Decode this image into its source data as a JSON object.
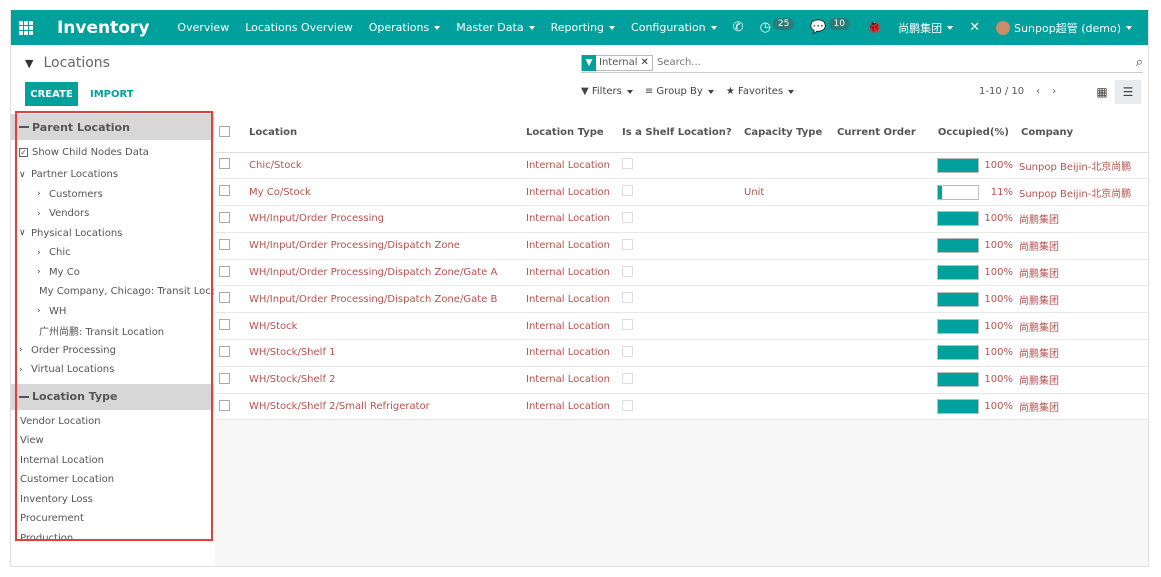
{
  "navbar": {
    "brand": "Inventory",
    "menu": [
      {
        "label": "Overview",
        "dropdown": false
      },
      {
        "label": "Locations Overview",
        "dropdown": false
      },
      {
        "label": "Operations",
        "dropdown": true
      },
      {
        "label": "Master Data",
        "dropdown": true
      },
      {
        "label": "Reporting",
        "dropdown": true
      },
      {
        "label": "Configuration",
        "dropdown": true
      }
    ],
    "activity_count": "25",
    "message_count": "10",
    "company_switcher": "尚鹏集团",
    "user": "Sunpop超管 (demo)"
  },
  "control_panel": {
    "breadcrumb": "Locations",
    "create_label": "CREATE",
    "import_label": "IMPORT",
    "search": {
      "facet_value": "Internal",
      "placeholder": "Search..."
    },
    "filters_label": "Filters",
    "group_by_label": "Group By",
    "favorites_label": "Favorites",
    "pager": "1-10 / 10"
  },
  "side_panel": {
    "parent_location_title": "Parent Location",
    "show_child_label": "Show Child Nodes Data",
    "tree": [
      {
        "label": "Partner Locations",
        "level": 0,
        "expanded": true
      },
      {
        "label": "Customers",
        "level": 1,
        "expanded": false
      },
      {
        "label": "Vendors",
        "level": 1,
        "expanded": false
      },
      {
        "label": "Physical Locations",
        "level": 0,
        "expanded": true
      },
      {
        "label": "Chic",
        "level": 1,
        "expanded": false
      },
      {
        "label": "My Co",
        "level": 1,
        "expanded": false
      },
      {
        "label": "My Company, Chicago: Transit Location",
        "level": 1,
        "leaf": true
      },
      {
        "label": "WH",
        "level": 1,
        "expanded": false
      },
      {
        "label": "广州尚鹏: Transit Location",
        "level": 1,
        "leaf": true
      },
      {
        "label": "Order Processing",
        "level": 0,
        "expanded": false
      },
      {
        "label": "Virtual Locations",
        "level": 0,
        "expanded": false
      }
    ],
    "location_type_title": "Location Type",
    "location_types": [
      "Vendor Location",
      "View",
      "Internal Location",
      "Customer Location",
      "Inventory Loss",
      "Procurement",
      "Production"
    ]
  },
  "table": {
    "columns": [
      "Location",
      "Location Type",
      "Is a Shelf Location?",
      "Capacity Type",
      "Current Order",
      "Occupied(%)",
      "Company"
    ],
    "rows": [
      {
        "location": "Chic/Stock",
        "type": "Internal Location",
        "capacity": "",
        "order": "",
        "occupied": 100,
        "occupied_label": "100%",
        "company": "Sunpop Beijin-北京尚鹏"
      },
      {
        "location": "My Co/Stock",
        "type": "Internal Location",
        "capacity": "Unit",
        "order": "",
        "occupied": 11,
        "occupied_label": "11%",
        "company": "Sunpop Beijin-北京尚鹏"
      },
      {
        "location": "WH/Input/Order Processing",
        "type": "Internal Location",
        "capacity": "",
        "order": "",
        "occupied": 100,
        "occupied_label": "100%",
        "company": "尚鹏集团"
      },
      {
        "location": "WH/Input/Order Processing/Dispatch Zone",
        "type": "Internal Location",
        "capacity": "",
        "order": "",
        "occupied": 100,
        "occupied_label": "100%",
        "company": "尚鹏集团"
      },
      {
        "location": "WH/Input/Order Processing/Dispatch Zone/Gate A",
        "type": "Internal Location",
        "capacity": "",
        "order": "",
        "occupied": 100,
        "occupied_label": "100%",
        "company": "尚鹏集团"
      },
      {
        "location": "WH/Input/Order Processing/Dispatch Zone/Gate B",
        "type": "Internal Location",
        "capacity": "",
        "order": "",
        "occupied": 100,
        "occupied_label": "100%",
        "company": "尚鹏集团"
      },
      {
        "location": "WH/Stock",
        "type": "Internal Location",
        "capacity": "",
        "order": "",
        "occupied": 100,
        "occupied_label": "100%",
        "company": "尚鹏集团"
      },
      {
        "location": "WH/Stock/Shelf 1",
        "type": "Internal Location",
        "capacity": "",
        "order": "",
        "occupied": 100,
        "occupied_label": "100%",
        "company": "尚鹏集团"
      },
      {
        "location": "WH/Stock/Shelf 2",
        "type": "Internal Location",
        "capacity": "",
        "order": "",
        "occupied": 100,
        "occupied_label": "100%",
        "company": "尚鹏集团"
      },
      {
        "location": "WH/Stock/Shelf 2/Small Refrigerator",
        "type": "Internal Location",
        "capacity": "",
        "order": "",
        "occupied": 100,
        "occupied_label": "100%",
        "company": "尚鹏集团"
      }
    ]
  },
  "colors": {
    "primary": "#00a09d",
    "link": "#b5524f",
    "highlight": "#e2403d"
  }
}
